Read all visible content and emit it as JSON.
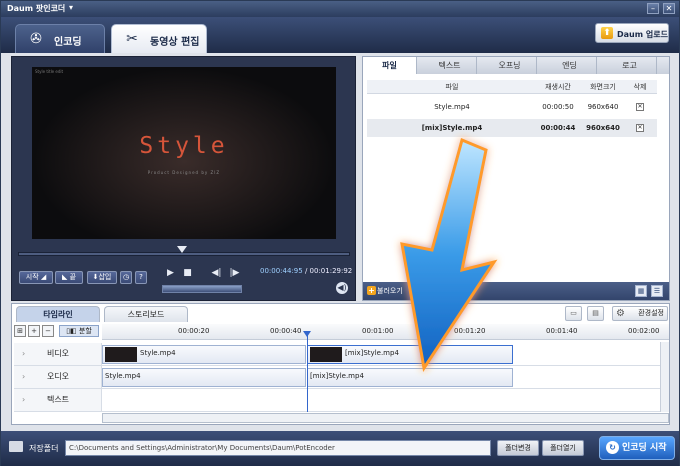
{
  "app": {
    "title": "Daum 팟인코더",
    "menu_arrow": "▾",
    "min": "–",
    "close": "✕"
  },
  "main_tabs": [
    {
      "label": "인코딩",
      "icon": "film-reel-icon"
    },
    {
      "label": "동영상 편집",
      "icon": "scissors-film-icon"
    }
  ],
  "upload_button": "Daum 업로드",
  "preview": {
    "corner_text": "Style title edit",
    "title_text": "Style",
    "subtitle_text": "Product Designed by ZIZ"
  },
  "player": {
    "start": "시작",
    "end": "끝",
    "insert": "삽입",
    "help": "?",
    "current_time": "00:00:44:95",
    "total_time": "/ 00:01:29:92",
    "progress": 0.5
  },
  "right_tabs": [
    "파일",
    "텍스트",
    "오프닝",
    "엔딩",
    "로고"
  ],
  "file_table": {
    "headers": [
      "파일",
      "재생시간",
      "화면크기",
      "삭제"
    ],
    "rows": [
      {
        "name": "Style.mp4",
        "duration": "00:00:50",
        "size": "960x640"
      },
      {
        "name": "[mix]Style.mp4",
        "duration": "00:00:44",
        "size": "960x640"
      }
    ]
  },
  "add_button": "불러오기",
  "timeline": {
    "tabs": [
      "타임라인",
      "스토리보드"
    ],
    "settings": "환경설정",
    "split": "분할",
    "ticks": [
      "00:00:20",
      "00:00:40",
      "00:01:00",
      "00:01:20",
      "00:01:40",
      "00:02:00"
    ],
    "tracks": [
      {
        "name": "비디오",
        "clips": [
          "Style.mp4",
          "[mix]Style.mp4"
        ]
      },
      {
        "name": "오디오",
        "clips": [
          "Style.mp4",
          "[mix]Style.mp4"
        ]
      },
      {
        "name": "텍스트",
        "clips": []
      }
    ]
  },
  "bottom": {
    "save_folder": "저장폴더",
    "path": "C:\\Documents and Settings\\Administrator\\My Documents\\Daum\\PotEncoder",
    "change_folder": "폴더변경",
    "open_folder": "폴더열기",
    "encode": "인코딩 시작"
  }
}
